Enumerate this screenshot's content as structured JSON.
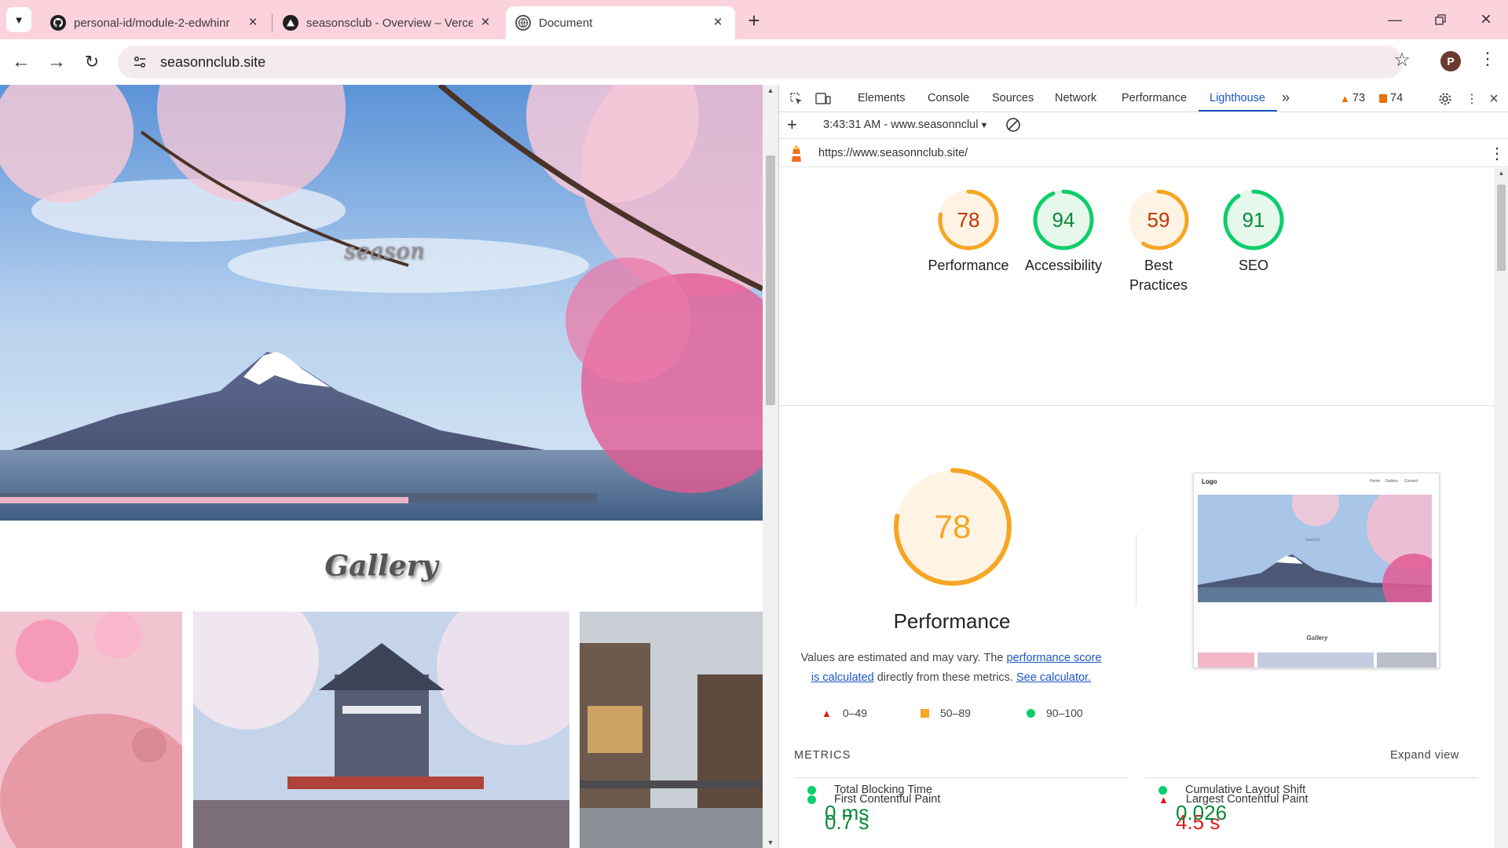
{
  "tabs": [
    {
      "title": "personal-id/module-2-edwhinr",
      "icon": "github-icon"
    },
    {
      "title": "seasonsclub - Overview – Verce",
      "icon": "vercel-icon"
    },
    {
      "title": "Document",
      "icon": "globe-icon"
    }
  ],
  "toolbar": {
    "url": "seasonnclub.site",
    "avatar_letter": "P"
  },
  "page": {
    "hero_title": "season",
    "gallery_title": "Gallery"
  },
  "devtools": {
    "tabs": [
      "Elements",
      "Console",
      "Sources",
      "Network",
      "Performance",
      "Lighthouse"
    ],
    "active_tab": "Lighthouse",
    "warnings": "73",
    "issues": "74",
    "report_selector": "3:43:31 AM - www.seasonnclul",
    "report_url": "https://www.seasonnclub.site/"
  },
  "lighthouse": {
    "scores": [
      {
        "label": "Performance",
        "value": 78,
        "status": "average"
      },
      {
        "label": "Accessibility",
        "value": 94,
        "status": "pass"
      },
      {
        "label": "Best Practices",
        "value": 59,
        "status": "average"
      },
      {
        "label": "SEO",
        "value": 91,
        "status": "pass"
      }
    ],
    "main_score": 78,
    "main_title": "Performance",
    "desc": {
      "before": "Values are estimated and may vary. The ",
      "link1": "performance score is calculated",
      "middle": " directly from these metrics. ",
      "link2": "See calculator."
    },
    "legend": [
      "0–49",
      "50–89",
      "90–100"
    ],
    "preview": {
      "logo": "Logo",
      "nav": [
        "Home",
        "Gallery",
        "Contact"
      ],
      "title": "season",
      "gallery": "Gallery"
    },
    "metrics_heading": "METRICS",
    "expand_label": "Expand view",
    "metrics": [
      {
        "name": "First Contentful Paint",
        "value": "0.7 s",
        "status": "pass"
      },
      {
        "name": "Largest Contentful Paint",
        "value": "4.5 s",
        "status": "fail"
      },
      {
        "name": "Total Blocking Time",
        "value": "0 ms",
        "status": "pass"
      },
      {
        "name": "Cumulative Layout Shift",
        "value": "0.026",
        "status": "pass"
      }
    ]
  },
  "colors": {
    "pass": "#0a8a3a",
    "average": "#c33300",
    "fail": "#e01b1b",
    "accent": "#1a56c8",
    "tabstrip": "#fcd2dc"
  }
}
